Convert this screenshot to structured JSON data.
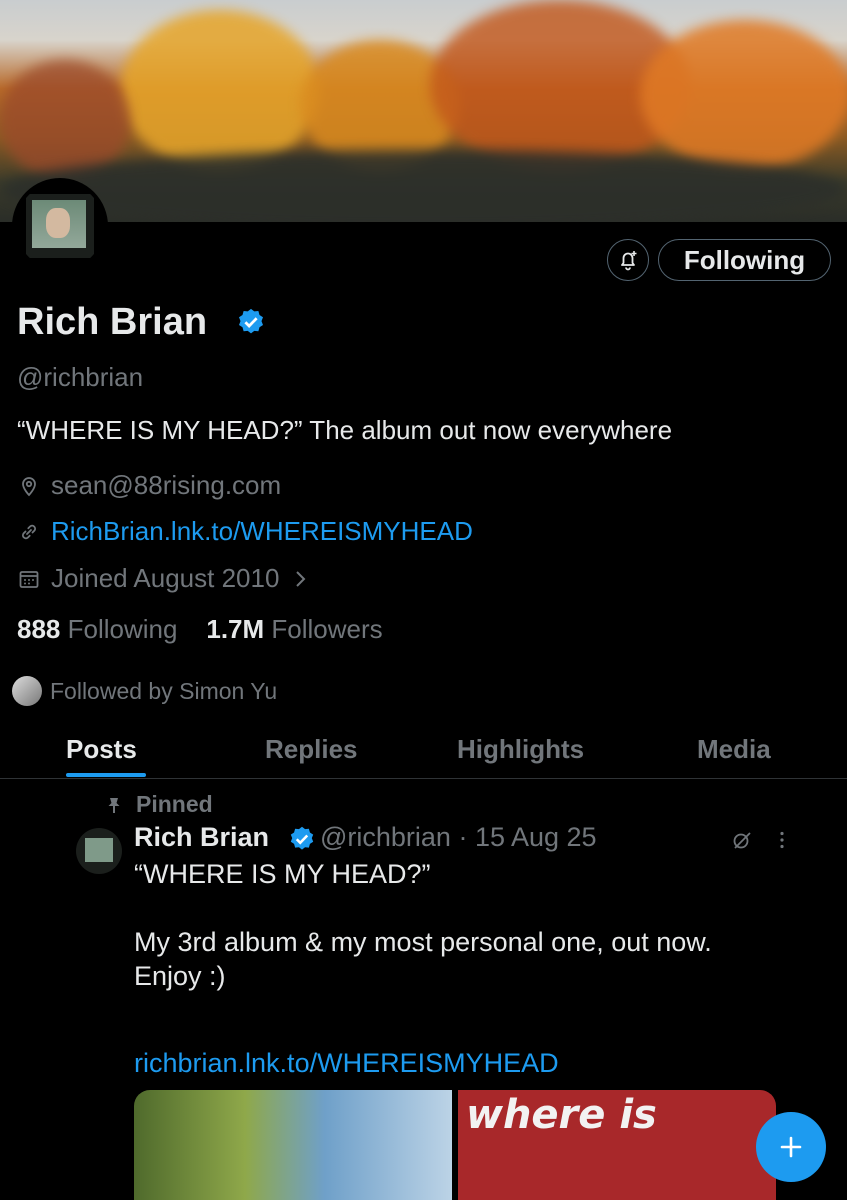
{
  "profile": {
    "name": "Rich Brian",
    "handle": "@richbrian",
    "bio": "“WHERE IS MY HEAD?” The album out now everywhere",
    "location": "sean@88rising.com",
    "website": "RichBrian.lnk.to/WHEREISMYHEAD",
    "joined": "Joined August 2010",
    "following_count": "888",
    "following_label": "Following",
    "followers_count": "1.7M",
    "followers_label": "Followers",
    "followed_by": "Followed by Simon Yu"
  },
  "actions": {
    "following_button": "Following",
    "bell_icon": "notification-bell-icon"
  },
  "tabs": [
    {
      "label": "Posts",
      "active": true
    },
    {
      "label": "Replies",
      "active": false
    },
    {
      "label": "Highlights",
      "active": false
    },
    {
      "label": "Media",
      "active": false
    }
  ],
  "pinned_post": {
    "pinned_label": "Pinned",
    "author": "Rich Brian",
    "handle_date": "@richbrian · 15 Aug 25",
    "text_line1": "“WHERE IS MY HEAD?”",
    "text_line2": "My 3rd album & my most personal one, out now. Enjoy :)",
    "link": "richbrian.lnk.to/WHEREISMYHEAD",
    "image2_text": "where is"
  },
  "colors": {
    "accent": "#1d9bf0",
    "muted": "#71767b",
    "text": "#e7e9ea",
    "background": "#000000"
  }
}
